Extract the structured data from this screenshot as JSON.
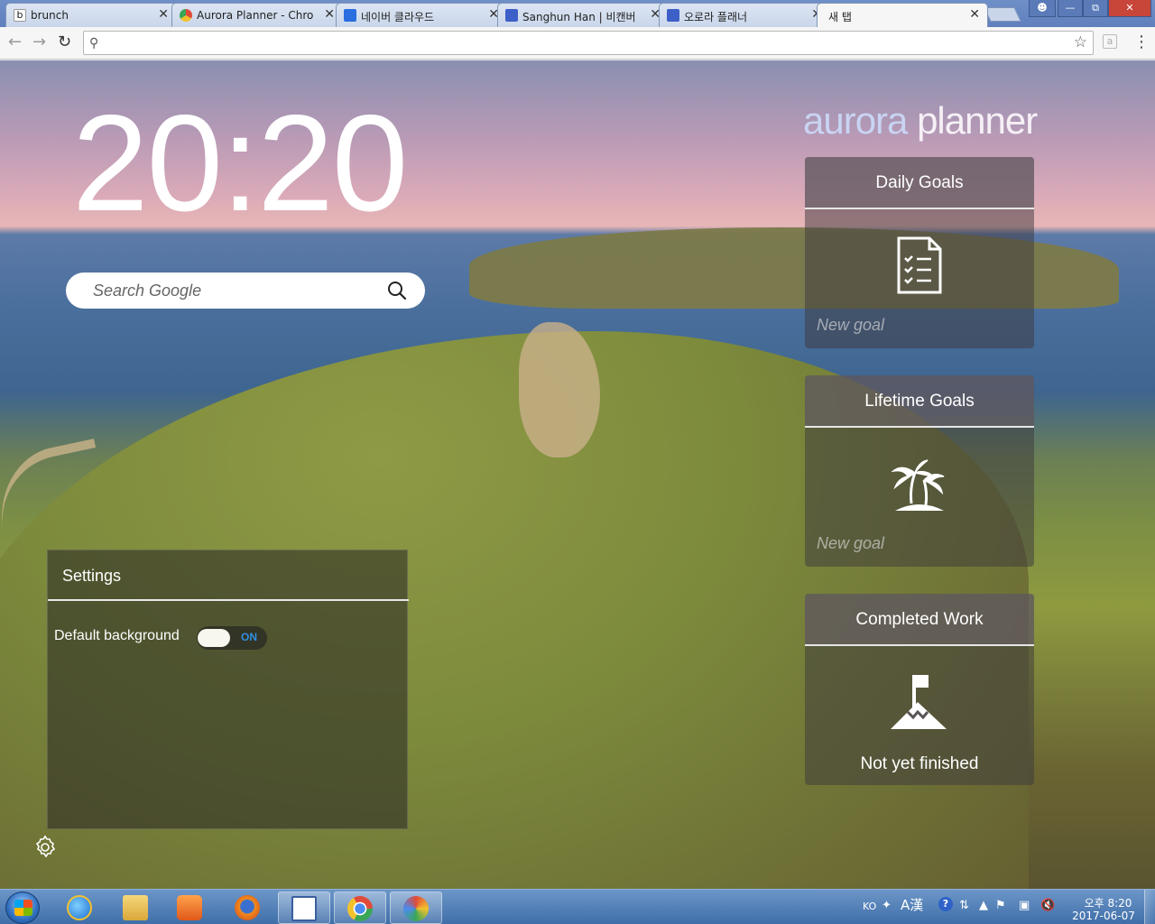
{
  "browser": {
    "tabs": [
      {
        "title": "brunch",
        "favicon": "brunch-icon",
        "color": "#ffffff"
      },
      {
        "title": "Aurora Planner - Chro",
        "favicon": "chrome-webstore-icon",
        "color": "#e04a3a"
      },
      {
        "title": "네이버 클라우드",
        "favicon": "naver-cloud-icon",
        "color": "#2a6ee0"
      },
      {
        "title": "Sanghun Han | 비캔버",
        "favicon": "aurora-app-icon",
        "color": "#3d5fc8"
      },
      {
        "title": "오로라 플래너",
        "favicon": "aurora-app-icon",
        "color": "#3d5fc8"
      },
      {
        "title": "새 탭",
        "favicon": "",
        "color": "#f6f6f6"
      }
    ],
    "close_glyph": "✕",
    "address_value": "",
    "address_placeholder": ""
  },
  "clock": {
    "time": "20:20"
  },
  "search": {
    "placeholder": "Search Google"
  },
  "settings": {
    "title": "Settings",
    "option_label": "Default background",
    "toggle_state": "ON",
    "toggle_on": true
  },
  "brand": {
    "part1": "aurora",
    "part2": " planner"
  },
  "cards": {
    "daily": {
      "title": "Daily Goals",
      "placeholder": "New goal",
      "icon": "checklist-icon"
    },
    "lifetime": {
      "title": "Lifetime Goals",
      "placeholder": "New goal",
      "icon": "palm-island-icon"
    },
    "completed": {
      "title": "Completed Work",
      "status": "Not yet finished",
      "icon": "mountain-flag-icon"
    }
  },
  "taskbar": {
    "lang": "KO",
    "ime": "A漢",
    "help": "?",
    "time": "오후 8:20",
    "date": "2017-06-07"
  },
  "colors": {
    "toggle_text": "#2f8fe0",
    "brand_accent": "#c8d4f2"
  }
}
